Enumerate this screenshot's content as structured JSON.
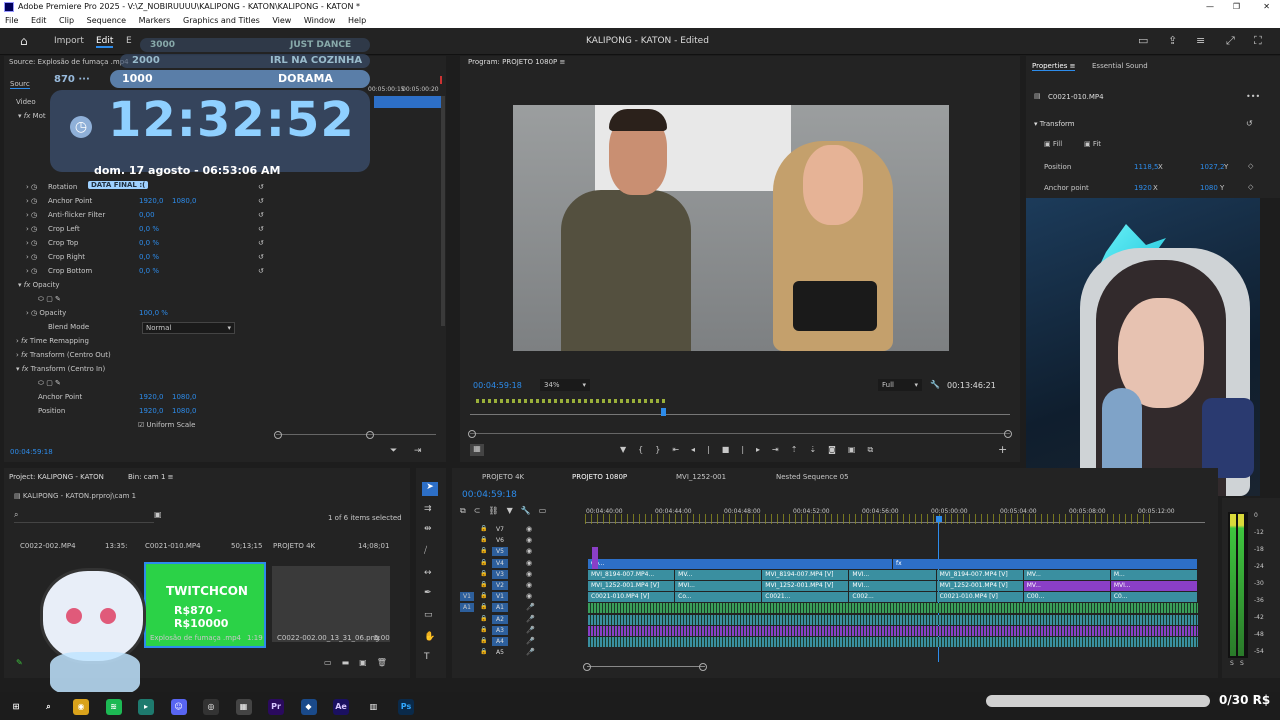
{
  "window": {
    "title": "Adobe Premiere Pro 2025 - V:\\Z_NOBIRUUUU\\KALIPONG - KATON\\KALIPONG - KATON *",
    "min": "—",
    "max": "❐",
    "close": "✕"
  },
  "menu": [
    "File",
    "Edit",
    "Clip",
    "Sequence",
    "Markers",
    "Graphics and Titles",
    "View",
    "Window",
    "Help"
  ],
  "appbar": {
    "tabs": [
      "Import",
      "Edit",
      "E"
    ],
    "project_title": "KALIPONG - KATON - Edited"
  },
  "overlay": {
    "goal_rows": [
      {
        "amount": "3000",
        "label": "JUST DANCE"
      },
      {
        "amount": "2000",
        "label": "IRL NA COZINHA"
      },
      {
        "amount": "1000",
        "label": "DORAMA"
      }
    ],
    "side_number": "870",
    "clock": "12:32:52",
    "date_line": "dom. 17 agosto - 06:53:06 AM",
    "final_badge": "DATA FINAL :(",
    "twitchcon": "TWITCHCON",
    "range": "R$870 - R$10000",
    "wallet": "0/30 R$"
  },
  "source": {
    "title": "Source: Explosão de fumaça .mp4",
    "tab": "Sourc",
    "section": "Video",
    "motion": "Mot",
    "times": [
      "00:05:00:15",
      "00:05:00:20"
    ],
    "rows": [
      {
        "label": "Rotation",
        "v1": "",
        "v2": ""
      },
      {
        "label": "Anchor Point",
        "v1": "1920,0",
        "v2": "1080,0"
      },
      {
        "label": "Anti-flicker Filter",
        "v1": "0,00",
        "v2": ""
      },
      {
        "label": "Crop Left",
        "v1": "0,0 %",
        "v2": ""
      },
      {
        "label": "Crop Top",
        "v1": "0,0 %",
        "v2": ""
      },
      {
        "label": "Crop Right",
        "v1": "0,0 %",
        "v2": ""
      },
      {
        "label": "Crop Bottom",
        "v1": "0,0 %",
        "v2": ""
      }
    ],
    "opacity_section": "Opacity",
    "opacity_label": "Opacity",
    "opacity_value": "100,0 %",
    "blend_label": "Blend Mode",
    "blend_value": "Normal",
    "time_remap": "Time Remapping",
    "transform_out": "Transform (Centro Out)",
    "transform_in": "Transform (Centro In)",
    "ti_rows": [
      {
        "label": "Anchor Point",
        "v1": "1920,0",
        "v2": "1080,0"
      },
      {
        "label": "Position",
        "v1": "1920,0",
        "v2": "1080,0"
      }
    ],
    "uniform": "Uniform Scale",
    "timecode": "00:04:59:18"
  },
  "program": {
    "title": "Program: PROJETO 1080P",
    "timecode": "00:04:59:18",
    "zoom": "34%",
    "quality": "Full",
    "duration": "00:13:46:21"
  },
  "properties": {
    "tabs": [
      "Properties",
      "Essential Sound"
    ],
    "clip": "C0021-010.MP4",
    "section": "Transform",
    "fill": "Fill",
    "fit": "Fit",
    "position_label": "Position",
    "position_x": "1118,5",
    "position_y": "1027,2",
    "anchor_label": "Anchor point",
    "anchor_x": "1920",
    "anchor_y": "1080",
    "x": "X",
    "y": "Y"
  },
  "project": {
    "title": "Project: KALIPONG - KATON",
    "bin": "Bin: cam 1",
    "path": "KALIPONG - KATON.prproj\\cam 1",
    "count": "1 of 6 items selected",
    "items": [
      {
        "name": "C0022-002.MP4",
        "meta": "13:35:",
        "extra": ""
      },
      {
        "name": "C0021-010.MP4",
        "meta": "50;13;15",
        "extra": "Explosão de fumaça .mp4",
        "extra_meta": "1:19"
      },
      {
        "name": "PROJETO 4K",
        "meta": "14;08;01",
        "extra": "C0022-002.00_13_31_06.png",
        "extra_meta": "5:00"
      }
    ]
  },
  "timeline": {
    "tabs": [
      "PROJETO 4K",
      "PROJETO 1080P",
      "MVI_1252-001",
      "Nested Sequence 05"
    ],
    "timecode": "00:04:59:18",
    "ruler": [
      "00:04:40:00",
      "00:04:44:00",
      "00:04:48:00",
      "00:04:52:00",
      "00:04:56:00",
      "00:05:00:00",
      "00:05:04:00",
      "00:05:08:00",
      "00:05:12:00"
    ],
    "video_tracks": [
      "V7",
      "V6",
      "V5",
      "V4",
      "V3",
      "V2",
      "V1"
    ],
    "audio_tracks": [
      "A1",
      "A2",
      "A3",
      "A4",
      "A5"
    ],
    "src_v": "V1",
    "src_a": "A1",
    "clips": [
      {
        "label": "Co...",
        "track": 3
      },
      {
        "label": "fx",
        "track": 3
      },
      {
        "label": "MVI_8194-007.MP4...",
        "track": 4
      },
      {
        "label": "MV...",
        "track": 4
      },
      {
        "label": "MVI_8194-007.MP4 [V]",
        "track": 4
      },
      {
        "label": "MVI...",
        "track": 4
      },
      {
        "label": "MVI_8194-007.MP4 [V]",
        "track": 4
      },
      {
        "label": "MV...",
        "track": 4
      },
      {
        "label": "M...",
        "track": 4
      },
      {
        "label": "MVI_1252-001.MP4 [V]",
        "track": 5
      },
      {
        "label": "MVI...",
        "track": 5
      },
      {
        "label": "MVI_1252-001.MP4 [V]",
        "track": 5
      },
      {
        "label": "MVI...",
        "track": 5
      },
      {
        "label": "MVI_1252-001.MP4 [V]",
        "track": 5
      },
      {
        "label": "MV...",
        "track": 5
      },
      {
        "label": "MVI...",
        "track": 5
      },
      {
        "label": "C0021-010.MP4 [V]",
        "track": 6
      },
      {
        "label": "Co...",
        "track": 6
      },
      {
        "label": "C0021...",
        "track": 6
      },
      {
        "label": "C002...",
        "track": 6
      },
      {
        "label": "C0021-010.MP4 [V]",
        "track": 6
      },
      {
        "label": "C00...",
        "track": 6
      },
      {
        "label": "C0...",
        "track": 6
      }
    ]
  },
  "meters": {
    "scale": [
      "0",
      "-12",
      "-18",
      "-24",
      "-30",
      "-36",
      "-42",
      "-48",
      "-54"
    ],
    "solo": "S"
  },
  "colors": {
    "accent": "#2d8ceb",
    "clip_video": "#3a8fa0",
    "clip_purple": "#8a3fc7",
    "clip_audio": "#3aa05a",
    "overlay_blue": "#7ec6ff"
  },
  "taskbar": {
    "apps": [
      "start-icon",
      "search-icon",
      "chrome-icon",
      "spotify-icon",
      "terminal-icon",
      "discord-icon",
      "obs-icon",
      "app-icon",
      "premiere-icon",
      "tool-icon",
      "after-effects-icon",
      "files-icon",
      "photoshop-icon"
    ],
    "labels": {
      "premiere": "Pr",
      "ae": "Ae",
      "ps": "Ps"
    }
  }
}
